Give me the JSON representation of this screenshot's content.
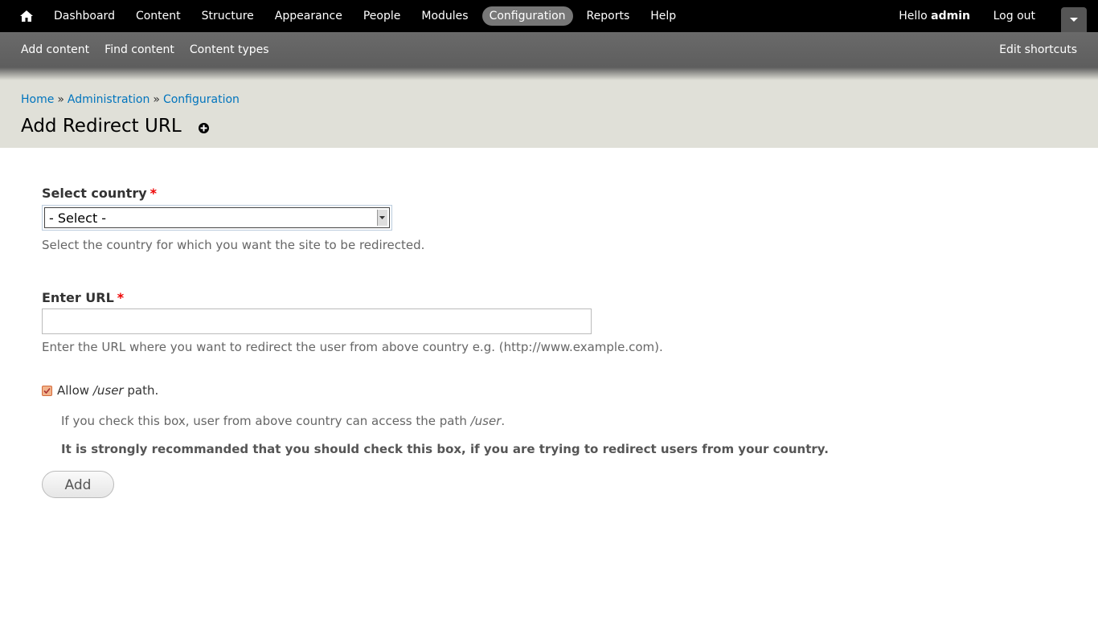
{
  "toolbar": {
    "menu": [
      "Dashboard",
      "Content",
      "Structure",
      "Appearance",
      "People",
      "Modules",
      "Configuration",
      "Reports",
      "Help"
    ],
    "active_index": 6,
    "hello": "Hello",
    "username": "admin",
    "logout": "Log out",
    "home_icon": "home-icon"
  },
  "shortcuts": {
    "links": [
      "Add content",
      "Find content",
      "Content types"
    ],
    "edit": "Edit shortcuts"
  },
  "breadcrumb": {
    "items": [
      "Home",
      "Administration",
      "Configuration"
    ],
    "separator": "»"
  },
  "page": {
    "title": "Add Redirect URL"
  },
  "form": {
    "country_label": "Select country",
    "required_mark": "*",
    "country_value": "- Select -",
    "country_desc": "Select the country for which you want the site to be redirected.",
    "url_label": "Enter URL",
    "url_value": "",
    "url_desc": "Enter the URL where you want to redirect the user from above country e.g. (http://www.example.com).",
    "allow_checked": true,
    "allow_label_pre": "Allow ",
    "allow_label_path": "/user",
    "allow_label_post": " path.",
    "allow_desc_pre": "If you check this box, user from above country can access the path ",
    "allow_desc_path": "/user",
    "allow_desc_post": ".",
    "allow_warning": "It is strongly recommanded that you should check this box, if you are trying to redirect users from your country.",
    "submit": "Add"
  },
  "colors": {
    "link": "#0074bd",
    "required": "#e00000",
    "active_menu_bg": "#777777"
  }
}
